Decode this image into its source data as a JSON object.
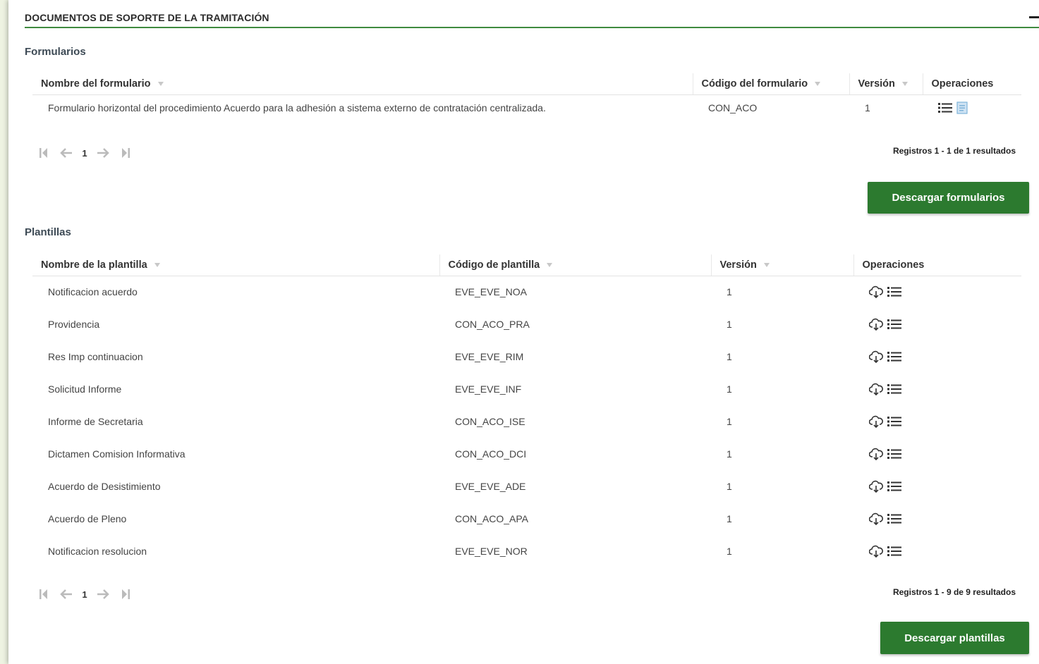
{
  "section": {
    "title": "DOCUMENTOS DE SOPORTE DE LA TRAMITACIÓN"
  },
  "formularios": {
    "title": "Formularios",
    "columns": [
      "Nombre del formulario",
      "Código del formulario",
      "Versión",
      "Operaciones"
    ],
    "rows": [
      {
        "name": "Formulario horizontal del procedimiento Acuerdo para la adhesión a sistema externo de contratación centralizada.",
        "code": "CON_ACO",
        "version": "1"
      }
    ],
    "page": "1",
    "records": "Registros 1 - 1 de 1 resultados",
    "download_label": "Descargar formularios"
  },
  "plantillas": {
    "title": "Plantillas",
    "columns": [
      "Nombre de la plantilla",
      "Código de plantilla",
      "Versión",
      "Operaciones"
    ],
    "rows": [
      {
        "name": "Notificacion acuerdo",
        "code": "EVE_EVE_NOA",
        "version": "1"
      },
      {
        "name": "Providencia",
        "code": "CON_ACO_PRA",
        "version": "1"
      },
      {
        "name": "Res Imp continuacion",
        "code": "EVE_EVE_RIM",
        "version": "1"
      },
      {
        "name": "Solicitud Informe",
        "code": "EVE_EVE_INF",
        "version": "1"
      },
      {
        "name": "Informe de Secretaria",
        "code": "CON_ACO_ISE",
        "version": "1"
      },
      {
        "name": "Dictamen Comision Informativa",
        "code": "CON_ACO_DCI",
        "version": "1"
      },
      {
        "name": "Acuerdo de Desistimiento",
        "code": "EVE_EVE_ADE",
        "version": "1"
      },
      {
        "name": "Acuerdo de Pleno",
        "code": "CON_ACO_APA",
        "version": "1"
      },
      {
        "name": "Notificacion resolucion",
        "code": "EVE_EVE_NOR",
        "version": "1"
      }
    ],
    "page": "1",
    "records": "Registros 1 - 9 de 9 resultados",
    "download_label": "Descargar plantillas"
  },
  "icons": {
    "list": "list-icon",
    "cloud_download": "cloud-download-icon",
    "document": "document-icon",
    "first_page": "first-page-icon",
    "prev_page": "prev-page-icon",
    "next_page": "next-page-icon",
    "last_page": "last-page-icon"
  },
  "colors": {
    "accent_green": "#2c7a2f",
    "header_rule": "#3f8a3f",
    "doc_icon": "#7fb3d9"
  }
}
